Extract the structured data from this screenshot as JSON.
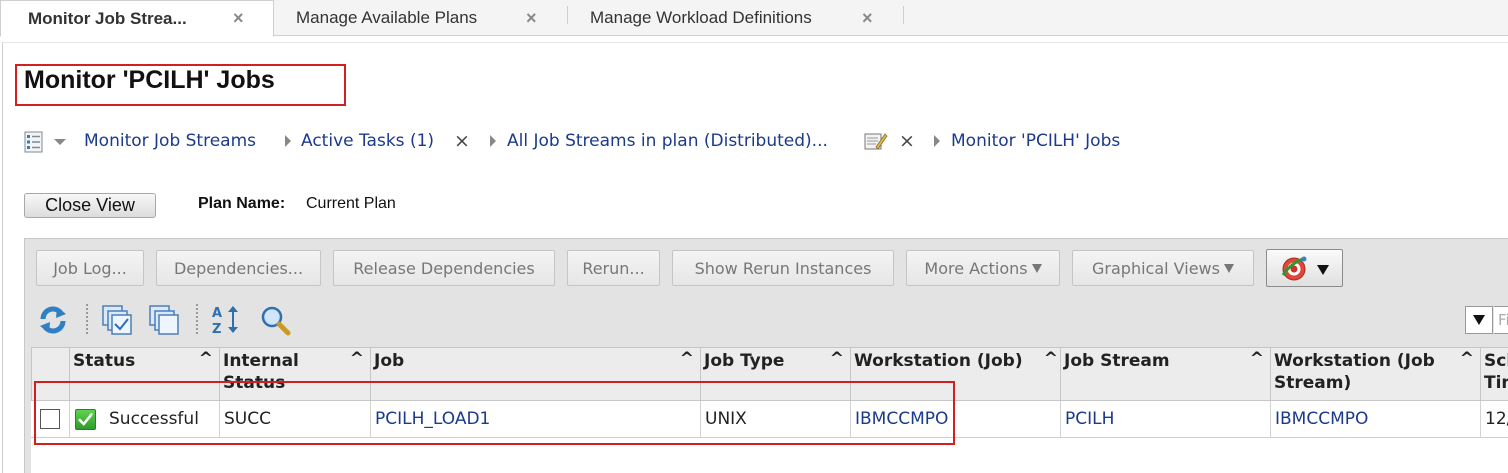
{
  "tabs": [
    {
      "label": "Monitor Job Strea...",
      "active": true
    },
    {
      "label": "Manage Available Plans",
      "active": false
    },
    {
      "label": "Manage Workload Definitions",
      "active": false
    }
  ],
  "page_title": "Monitor 'PCILH' Jobs",
  "breadcrumb": [
    {
      "label": "Monitor Job Streams"
    },
    {
      "label": "Active Tasks (1)"
    },
    {
      "label": "All Job Streams in plan (Distributed)..."
    },
    {
      "label": "Monitor 'PCILH' Jobs"
    }
  ],
  "close_view_label": "Close View",
  "plan": {
    "label": "Plan Name:",
    "value": "Current Plan"
  },
  "actions": {
    "job_log": "Job Log...",
    "dependencies": "Dependencies...",
    "release_dependencies": "Release Dependencies",
    "rerun": "Rerun...",
    "show_rerun_instances": "Show Rerun Instances",
    "more_actions": "More Actions",
    "graphical_views": "Graphical Views"
  },
  "toolbar_icons": [
    "refresh-icon",
    "select-all-icon",
    "deselect-all-icon",
    "sort-az-icon",
    "find-icon"
  ],
  "filter": {
    "placeholder": "Fi"
  },
  "table": {
    "columns": [
      {
        "line1": "Status",
        "line2": ""
      },
      {
        "line1": "Internal",
        "line2": "Status"
      },
      {
        "line1": "Job",
        "line2": ""
      },
      {
        "line1": "Job Type",
        "line2": ""
      },
      {
        "line1": "Workstation (Job)",
        "line2": ""
      },
      {
        "line1": "Job Stream",
        "line2": ""
      },
      {
        "line1": "Workstation (Job",
        "line2": "Stream)"
      },
      {
        "line1": "Sch",
        "line2": "Tim"
      }
    ],
    "sort_glyph": "^",
    "rows": [
      {
        "status": "Successful",
        "internal_status": "SUCC",
        "job": "PCILH_LOAD1",
        "job_type": "UNIX",
        "workstation_job": "IBMCCMPO",
        "job_stream": "PCILH",
        "workstation_job_stream": "IBMCCMPO",
        "sched_time": "12/"
      }
    ]
  },
  "colors": {
    "highlight": "#d02020",
    "link": "#1b3a8c",
    "success": "#2f9a2a"
  }
}
